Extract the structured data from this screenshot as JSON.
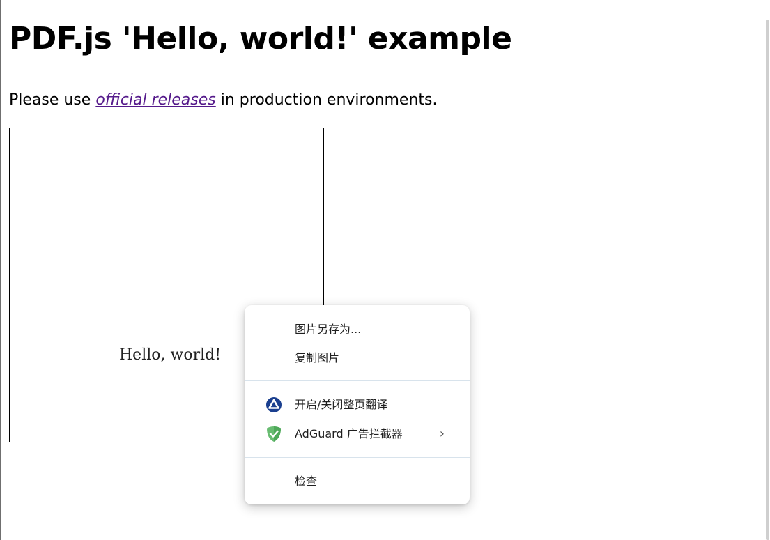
{
  "page": {
    "title": "PDF.js 'Hello, world!' example",
    "intro_before": "Please use ",
    "intro_link": "official releases",
    "intro_after": " in production environments."
  },
  "pdf": {
    "text": "Hello, world!"
  },
  "context_menu": {
    "items": [
      {
        "label": "图片另存为..."
      },
      {
        "label": "复制图片"
      },
      {
        "label": "开启/关闭整页翻译",
        "icon": "translate-icon"
      },
      {
        "label": "AdGuard 广告拦截器",
        "icon": "adguard-shield-icon",
        "has_submenu": true
      },
      {
        "label": "检查"
      }
    ]
  },
  "colors": {
    "link": "#551a8b",
    "translate_icon": "#1a3f8f",
    "adguard_icon": "#68bc71"
  }
}
